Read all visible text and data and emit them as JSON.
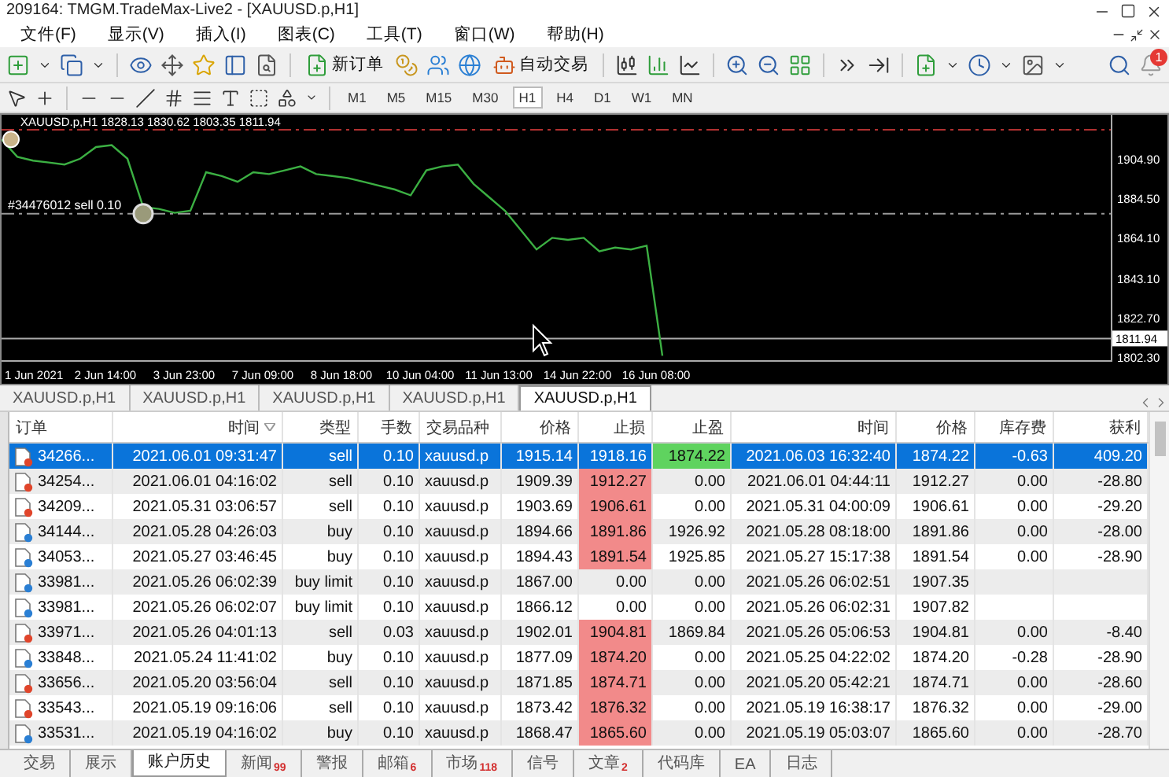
{
  "window": {
    "title": "209164: TMGM.TradeMax-Live2 - [XAUUSD.p,H1]"
  },
  "menu": [
    "文件(F)",
    "显示(V)",
    "插入(I)",
    "图表(C)",
    "工具(T)",
    "窗口(W)",
    "帮助(H)"
  ],
  "toolbar": {
    "new_order": "新订单",
    "auto_trading": "自动交易",
    "notification_count": "1"
  },
  "timeframes": [
    {
      "label": "M1",
      "selected": false
    },
    {
      "label": "M5",
      "selected": false
    },
    {
      "label": "M15",
      "selected": false
    },
    {
      "label": "M30",
      "selected": false
    },
    {
      "label": "H1",
      "selected": true
    },
    {
      "label": "H4",
      "selected": false
    },
    {
      "label": "D1",
      "selected": false
    },
    {
      "label": "W1",
      "selected": false
    },
    {
      "label": "MN",
      "selected": false
    }
  ],
  "chart": {
    "header": "XAUUSD.p,H1  1828.13 1830.62 1803.35 1811.94",
    "chart_data": {
      "type": "line",
      "categories": [
        null,
        null,
        "1 Jun 2021",
        null,
        null,
        null,
        null,
        "2 Jun 14:00",
        null,
        null,
        null,
        null,
        "3 Jun 23:00",
        null,
        null,
        null,
        null,
        "7 Jun 09:00",
        null,
        null,
        null,
        null,
        "8 Jun 18:00",
        null,
        null,
        null,
        null,
        "10 Jun 04:00",
        null,
        null,
        null,
        null,
        "11 Jun 13:00",
        null,
        null,
        null,
        null,
        "14 Jun 22:00",
        null,
        null,
        null,
        null,
        "16 Jun 08:00"
      ],
      "series": [
        {
          "color": "#3cb043",
          "values": [
            1915,
            1906,
            1904,
            1903,
            1902,
            1905,
            1911,
            1912,
            1905,
            1880,
            1879,
            1877,
            1878,
            1898,
            1896,
            1893,
            1898,
            1897,
            1899,
            1901,
            1897,
            1896,
            1895,
            1893,
            1891,
            1889,
            1886,
            1899,
            1901,
            1902,
            1892,
            1885,
            1878,
            1868,
            1858,
            1864,
            1863,
            1864,
            1857,
            1859,
            1858,
            1860,
            1803
          ]
        }
      ],
      "ylim": [
        1800.7,
        1927.7
      ],
      "yticks": [
        {
          "value": 1904.9,
          "label": "1904.90"
        },
        {
          "value": 1884.5,
          "label": "1884.50"
        },
        {
          "value": 1864.1,
          "label": "1864.10"
        },
        {
          "value": 1843.1,
          "label": "1843.10"
        },
        {
          "value": 1822.7,
          "label": "1822.70"
        },
        {
          "value": 1802.3,
          "label": "1802.30"
        }
      ],
      "ref_lines": [
        {
          "axis": "y",
          "value": 1920,
          "color": "#b03030"
        },
        {
          "axis": "y",
          "value": 1876.5,
          "color": "#999999",
          "label": "#34476012 sell 0.10"
        },
        {
          "axis": "y",
          "value": 1811.94,
          "color": "#aaaaaa",
          "label": "1811.94"
        }
      ]
    }
  },
  "chart_tabs": [
    {
      "label": "XAUUSD.p,H1",
      "selected": false
    },
    {
      "label": "XAUUSD.p,H1",
      "selected": false
    },
    {
      "label": "XAUUSD.p,H1",
      "selected": false
    },
    {
      "label": "XAUUSD.p,H1",
      "selected": false
    },
    {
      "label": "XAUUSD.p,H1",
      "selected": true
    }
  ],
  "table": {
    "columns": [
      "订单",
      "时间",
      "类型",
      "手数",
      "交易品种",
      "价格",
      "止损",
      "止盈",
      "时间",
      "价格",
      "库存费",
      "获利"
    ],
    "rows": [
      {
        "kind": "sell",
        "selected": true,
        "sl_hit": false,
        "tp_hit": true,
        "cells": [
          "34266...",
          "2021.06.01 09:31:47",
          "sell",
          "0.10",
          "xauusd.p",
          "1915.14",
          "1918.16",
          "1874.22",
          "2021.06.03 16:32:40",
          "1874.22",
          "-0.63",
          "409.20"
        ]
      },
      {
        "kind": "sell",
        "selected": false,
        "sl_hit": true,
        "tp_hit": false,
        "cells": [
          "34254...",
          "2021.06.01 04:16:02",
          "sell",
          "0.10",
          "xauusd.p",
          "1909.39",
          "1912.27",
          "0.00",
          "2021.06.01 04:44:11",
          "1912.27",
          "0.00",
          "-28.80"
        ]
      },
      {
        "kind": "sell",
        "selected": false,
        "sl_hit": true,
        "tp_hit": false,
        "cells": [
          "34209...",
          "2021.05.31 03:06:57",
          "sell",
          "0.10",
          "xauusd.p",
          "1903.69",
          "1906.61",
          "0.00",
          "2021.05.31 04:00:09",
          "1906.61",
          "0.00",
          "-29.20"
        ]
      },
      {
        "kind": "buy",
        "selected": false,
        "sl_hit": true,
        "tp_hit": false,
        "cells": [
          "34144...",
          "2021.05.28 04:26:03",
          "buy",
          "0.10",
          "xauusd.p",
          "1894.66",
          "1891.86",
          "1926.92",
          "2021.05.28 08:18:00",
          "1891.86",
          "0.00",
          "-28.00"
        ]
      },
      {
        "kind": "buy",
        "selected": false,
        "sl_hit": true,
        "tp_hit": false,
        "cells": [
          "34053...",
          "2021.05.27 03:46:45",
          "buy",
          "0.10",
          "xauusd.p",
          "1894.43",
          "1891.54",
          "1925.85",
          "2021.05.27 15:17:38",
          "1891.54",
          "0.00",
          "-28.90"
        ]
      },
      {
        "kind": "buy",
        "selected": false,
        "sl_hit": false,
        "tp_hit": false,
        "cells": [
          "33981...",
          "2021.05.26 06:02:39",
          "buy limit",
          "0.10",
          "xauusd.p",
          "1867.00",
          "0.00",
          "0.00",
          "2021.05.26 06:02:51",
          "1907.35",
          null,
          null
        ]
      },
      {
        "kind": "buy",
        "selected": false,
        "sl_hit": false,
        "tp_hit": false,
        "cells": [
          "33981...",
          "2021.05.26 06:02:07",
          "buy limit",
          "0.10",
          "xauusd.p",
          "1866.12",
          "0.00",
          "0.00",
          "2021.05.26 06:02:31",
          "1907.82",
          null,
          null
        ]
      },
      {
        "kind": "sell",
        "selected": false,
        "sl_hit": true,
        "tp_hit": false,
        "cells": [
          "33971...",
          "2021.05.26 04:01:13",
          "sell",
          "0.03",
          "xauusd.p",
          "1902.01",
          "1904.81",
          "1869.84",
          "2021.05.26 05:06:53",
          "1904.81",
          "0.00",
          "-8.40"
        ]
      },
      {
        "kind": "buy",
        "selected": false,
        "sl_hit": true,
        "tp_hit": false,
        "cells": [
          "33848...",
          "2021.05.24 11:41:02",
          "buy",
          "0.10",
          "xauusd.p",
          "1877.09",
          "1874.20",
          "0.00",
          "2021.05.25 04:22:02",
          "1874.20",
          "-0.28",
          "-28.90"
        ]
      },
      {
        "kind": "sell",
        "selected": false,
        "sl_hit": true,
        "tp_hit": false,
        "cells": [
          "33656...",
          "2021.05.20 03:56:04",
          "sell",
          "0.10",
          "xauusd.p",
          "1871.85",
          "1874.71",
          "0.00",
          "2021.05.20 05:42:21",
          "1874.71",
          "0.00",
          "-28.60"
        ]
      },
      {
        "kind": "sell",
        "selected": false,
        "sl_hit": true,
        "tp_hit": false,
        "cells": [
          "33543...",
          "2021.05.19 09:16:06",
          "sell",
          "0.10",
          "xauusd.p",
          "1873.42",
          "1876.32",
          "0.00",
          "2021.05.19 16:38:17",
          "1876.32",
          "0.00",
          "-29.00"
        ]
      },
      {
        "kind": "buy",
        "selected": false,
        "sl_hit": true,
        "tp_hit": false,
        "cells": [
          "33531...",
          "2021.05.19 04:16:02",
          "buy",
          "0.10",
          "xauusd.p",
          "1868.47",
          "1865.60",
          "0.00",
          "2021.05.19 05:03:07",
          "1865.60",
          "0.00",
          "-28.70"
        ]
      }
    ]
  },
  "bottom_tabs": [
    {
      "label": "交易",
      "selected": false
    },
    {
      "label": "展示",
      "selected": false
    },
    {
      "label": "账户历史",
      "selected": true
    },
    {
      "label": "新闻",
      "badge": "99",
      "selected": false
    },
    {
      "label": "警报",
      "selected": false
    },
    {
      "label": "邮箱",
      "badge": "6",
      "selected": false
    },
    {
      "label": "市场",
      "badge": "118",
      "selected": false
    },
    {
      "label": "信号",
      "selected": false
    },
    {
      "label": "文章",
      "badge": "2",
      "selected": false
    },
    {
      "label": "代码库",
      "selected": false
    },
    {
      "label": "EA",
      "selected": false
    },
    {
      "label": "日志",
      "selected": false
    }
  ]
}
